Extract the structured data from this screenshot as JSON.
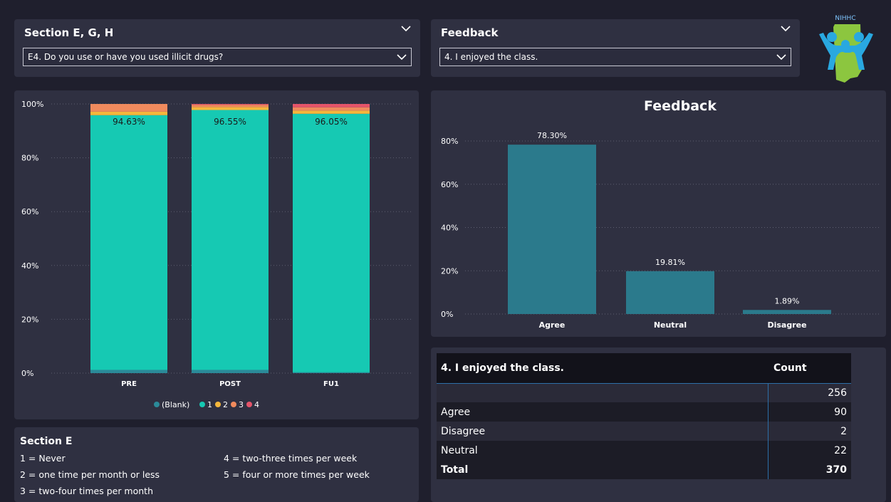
{
  "slicers": {
    "section": {
      "title": "Section E, G, H",
      "selected": "E4. Do you use or have you used illicit drugs?"
    },
    "feedback": {
      "title": "Feedback",
      "selected": "4. I enjoyed the class."
    }
  },
  "logo": {
    "text": "NIHHC"
  },
  "stacked_chart": {
    "y_ticks": [
      "100%",
      "80%",
      "60%",
      "40%",
      "20%",
      "0%"
    ],
    "legend": [
      "(Blank)",
      "1",
      "2",
      "3",
      "4"
    ],
    "colors": {
      "(Blank)": "#2b8a99",
      "1": "#16c9b3",
      "2": "#f6b73c",
      "3": "#f08a5d",
      "4": "#e5546a"
    }
  },
  "feedback_chart": {
    "title": "Feedback",
    "y_ticks": [
      "80%",
      "60%",
      "40%",
      "20%",
      "0%"
    ],
    "bar_color": "#2b7a8c"
  },
  "chart_data": [
    {
      "type": "bar",
      "stacked": true,
      "categories": [
        "PRE",
        "POST",
        "FU1"
      ],
      "series": [
        {
          "name": "(Blank)",
          "values": [
            1.2,
            1.2,
            0.3
          ]
        },
        {
          "name": "1",
          "values": [
            94.63,
            96.55,
            96.05
          ]
        },
        {
          "name": "2",
          "values": [
            1.3,
            1.1,
            1.2
          ]
        },
        {
          "name": "3",
          "values": [
            2.87,
            0.85,
            1.2
          ]
        },
        {
          "name": "4",
          "values": [
            0,
            0.3,
            1.25
          ]
        }
      ],
      "data_labels": [
        "94.63%",
        "96.55%",
        "96.05%"
      ],
      "ylim": [
        0,
        100
      ],
      "legend_position": "bottom-center"
    },
    {
      "type": "bar",
      "title": "Feedback",
      "categories": [
        "Agree",
        "Neutral",
        "Disagree"
      ],
      "values": [
        78.3,
        19.81,
        1.89
      ],
      "data_labels": [
        "78.30%",
        "19.81%",
        "1.89%"
      ],
      "ylim": [
        0,
        80
      ]
    }
  ],
  "key": {
    "title": "Section E",
    "items": [
      "1 = Never",
      "2 = one time per month or less",
      "3 = two-four times per month",
      "4 = two-three times per week",
      "5 = four or more times per week"
    ]
  },
  "matrix": {
    "headers": [
      "4. I enjoyed the class.",
      "Count"
    ],
    "rows": [
      {
        "label": "",
        "count": "256"
      },
      {
        "label": "Agree",
        "count": "90"
      },
      {
        "label": "Disagree",
        "count": "2"
      },
      {
        "label": "Neutral",
        "count": "22"
      }
    ],
    "total": {
      "label": "Total",
      "count": "370"
    }
  }
}
